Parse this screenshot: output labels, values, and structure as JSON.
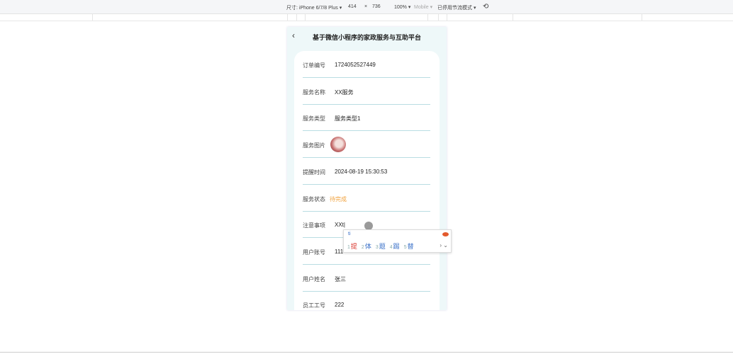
{
  "toolbar": {
    "device": "尺寸: iPhone 6/7/8 Plus ▾",
    "width": "414",
    "x": "×",
    "height": "736",
    "zoom": "100% ▾",
    "mode": "Mobile ▾",
    "throttle": "已停用节流模式 ▾",
    "rotate_icon": "rotate-icon"
  },
  "header": {
    "back": "‹",
    "title": "基于微信小程序的家政服务与互助平台"
  },
  "rows": [
    {
      "label": "订单编号",
      "value": "1724052527449"
    },
    {
      "label": "服务名称",
      "value": "XX服务"
    },
    {
      "label": "服务类型",
      "value": "服务类型1"
    },
    {
      "label": "服务图片",
      "value": ""
    },
    {
      "label": "提醒时间",
      "value": "2024-08-19 15:30:53"
    },
    {
      "label": "服务状态",
      "value": "待完成"
    },
    {
      "label": "注意事项",
      "value": "XXt|"
    },
    {
      "label": "用户账号",
      "value": "111"
    },
    {
      "label": "用户姓名",
      "value": "张三"
    },
    {
      "label": "员工工号",
      "value": "222"
    }
  ],
  "colors": {
    "status": "#f0a13c",
    "accent": "#3a70c8",
    "background": "#eef8f9"
  },
  "ime": {
    "composition": "ti",
    "candidates": [
      {
        "n": "1",
        "c": "提"
      },
      {
        "n": "2",
        "c": "体"
      },
      {
        "n": "3",
        "c": "题"
      },
      {
        "n": "4",
        "c": "踢"
      },
      {
        "n": "5",
        "c": "替"
      }
    ],
    "more": "› ⌄"
  }
}
